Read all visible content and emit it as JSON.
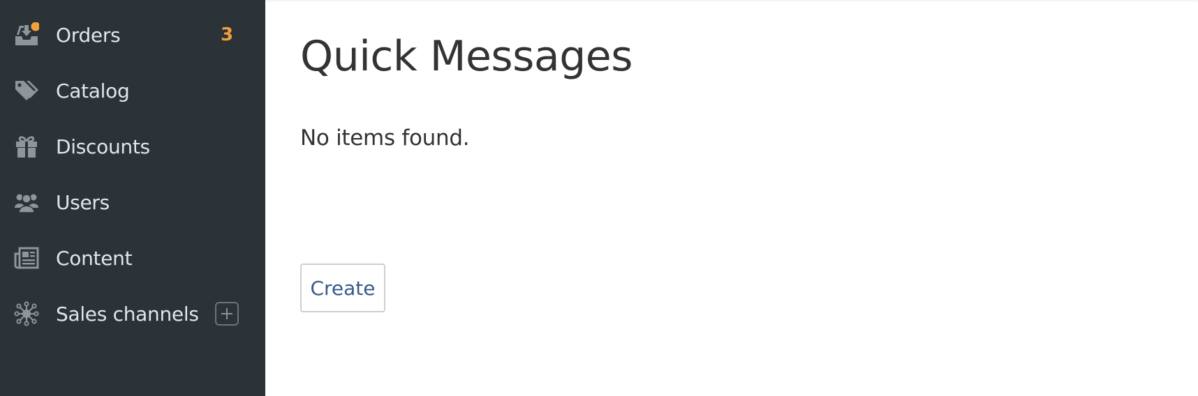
{
  "sidebar": {
    "items": [
      {
        "label": "Orders",
        "icon": "inbox-download-icon",
        "count": "3"
      },
      {
        "label": "Catalog",
        "icon": "tags-icon"
      },
      {
        "label": "Discounts",
        "icon": "gift-icon"
      },
      {
        "label": "Users",
        "icon": "users-icon"
      },
      {
        "label": "Content",
        "icon": "newspaper-icon"
      },
      {
        "label": "Sales channels",
        "icon": "network-icon",
        "action_icon": "plus-icon"
      }
    ]
  },
  "main": {
    "title": "Quick Messages",
    "empty_message": "No items found.",
    "create_button": "Create"
  },
  "colors": {
    "sidebar_bg": "#2b3238",
    "sidebar_text": "#e3e6e8",
    "sidebar_icon": "#8e959b",
    "badge": "#f0a03c",
    "link": "#355a8e",
    "title": "#333333"
  }
}
